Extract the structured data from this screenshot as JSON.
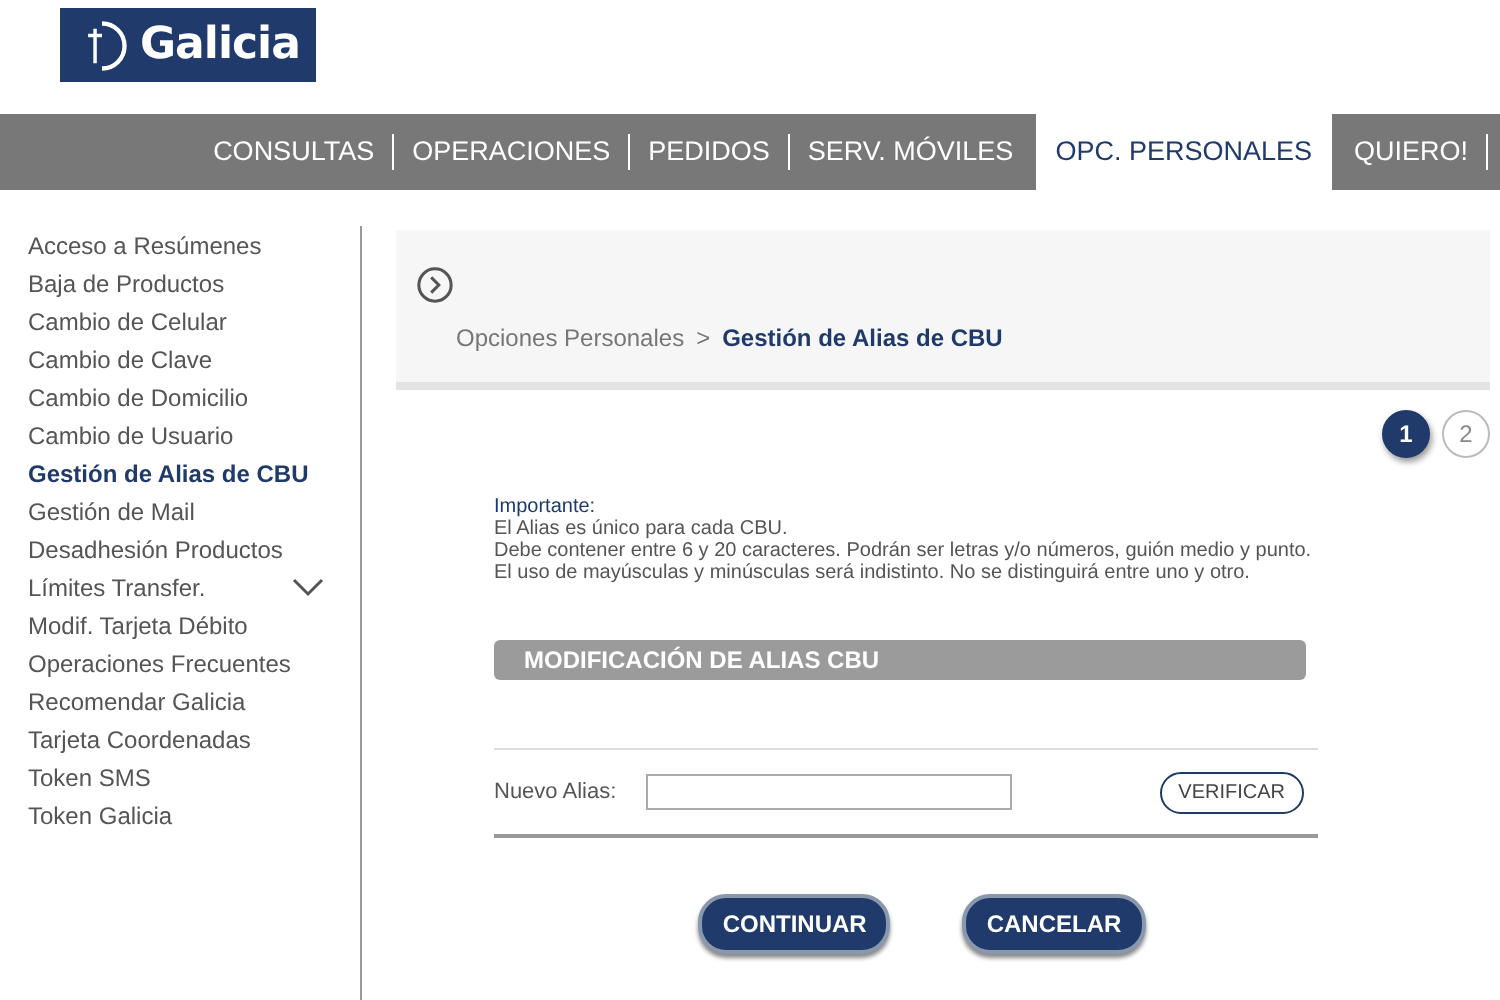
{
  "logo": {
    "text": "Galicia"
  },
  "nav": [
    {
      "label": "CONSULTAS",
      "selected": false
    },
    {
      "label": "OPERACIONES",
      "selected": false
    },
    {
      "label": "PEDIDOS",
      "selected": false
    },
    {
      "label": "SERV. MÓVILES",
      "selected": false
    },
    {
      "label": "OPC. PERSONALES",
      "selected": true
    },
    {
      "label": "QUIERO!",
      "selected": false
    }
  ],
  "sidebar": {
    "items": [
      {
        "label": "Acceso a Resúmenes",
        "selected": false
      },
      {
        "label": "Baja de Productos",
        "selected": false
      },
      {
        "label": "Cambio de Celular",
        "selected": false
      },
      {
        "label": "Cambio de Clave",
        "selected": false
      },
      {
        "label": "Cambio de Domicilio",
        "selected": false
      },
      {
        "label": "Cambio de Usuario",
        "selected": false
      },
      {
        "label": "Gestión de Alias de CBU",
        "selected": true
      },
      {
        "label": "Gestión de Mail",
        "selected": false
      },
      {
        "label": "Desadhesión Productos",
        "selected": false
      },
      {
        "label": "Límites Transfer.",
        "selected": false,
        "expanded": false
      },
      {
        "label": "Modif. Tarjeta Débito",
        "selected": false
      },
      {
        "label": "Operaciones Frecuentes",
        "selected": false
      },
      {
        "label": "Recomendar Galicia",
        "selected": false
      },
      {
        "label": "Tarjeta Coordenadas",
        "selected": false
      },
      {
        "label": "Token SMS",
        "selected": false
      },
      {
        "label": "Token Galicia",
        "selected": false
      }
    ]
  },
  "breadcrumb": {
    "parent": "Opciones Personales",
    "separator": ">",
    "current": "Gestión de Alias de CBU"
  },
  "steps": [
    {
      "label": "1",
      "selected": true
    },
    {
      "label": "2",
      "selected": false
    }
  ],
  "notice": {
    "title": "Importante:",
    "lines": [
      "El Alias es único para cada CBU.",
      "Debe contener entre 6 y 20 caracteres. Podrán ser letras y/o números, guión medio y punto.",
      "El uso de mayúsculas y minúsculas será indistinto. No se distinguirá entre uno y otro."
    ]
  },
  "section": {
    "title": "MODIFICACIÓN DE ALIAS CBU"
  },
  "form": {
    "label": "Nuevo Alias:",
    "verify_button": "VERIFICAR"
  },
  "buttons": [
    "CONTINUAR",
    "CANCELAR"
  ]
}
